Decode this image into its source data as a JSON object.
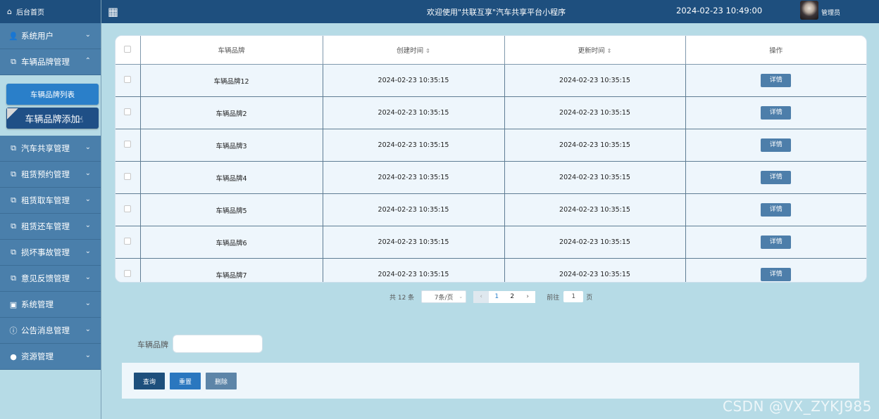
{
  "sidebar": {
    "brand": "后台首页",
    "menu": [
      {
        "label": "系统用户",
        "icon": "user-icon"
      },
      {
        "label": "车辆品牌管理",
        "icon": "folder-icon"
      }
    ],
    "submenu": [
      "车辆品牌列表",
      "车辆品牌添加"
    ],
    "menu2": [
      {
        "label": "汽车共享管理",
        "icon": "folder-icon"
      },
      {
        "label": "租赁预约管理",
        "icon": "folder-icon"
      },
      {
        "label": "租赁取车管理",
        "icon": "folder-icon"
      },
      {
        "label": "租赁还车管理",
        "icon": "folder-icon"
      },
      {
        "label": "损坏事故管理",
        "icon": "folder-icon"
      },
      {
        "label": "意见反馈管理",
        "icon": "folder-icon"
      },
      {
        "label": "系统管理",
        "icon": "image-icon"
      },
      {
        "label": "公告消息管理",
        "icon": "info-icon"
      },
      {
        "label": "资源管理",
        "icon": "location-icon"
      }
    ]
  },
  "header": {
    "welcome": "欢迎使用\"共联互享\"汽车共享平台小程序",
    "datetime": "2024-02-23 10:49:00",
    "user": "管理员"
  },
  "table": {
    "columns": [
      "车辆品牌",
      "创建时间",
      "更新时间",
      "操作"
    ],
    "rows": [
      {
        "brand": "车辆品牌12",
        "created": "2024-02-23 10:35:15",
        "updated": "2024-02-23 10:35:15",
        "action": "详情"
      },
      {
        "brand": "车辆品牌2",
        "created": "2024-02-23 10:35:15",
        "updated": "2024-02-23 10:35:15",
        "action": "详情"
      },
      {
        "brand": "车辆品牌3",
        "created": "2024-02-23 10:35:15",
        "updated": "2024-02-23 10:35:15",
        "action": "详情"
      },
      {
        "brand": "车辆品牌4",
        "created": "2024-02-23 10:35:15",
        "updated": "2024-02-23 10:35:15",
        "action": "详情"
      },
      {
        "brand": "车辆品牌5",
        "created": "2024-02-23 10:35:15",
        "updated": "2024-02-23 10:35:15",
        "action": "详情"
      },
      {
        "brand": "车辆品牌6",
        "created": "2024-02-23 10:35:15",
        "updated": "2024-02-23 10:35:15",
        "action": "详情"
      },
      {
        "brand": "车辆品牌7",
        "created": "2024-02-23 10:35:15",
        "updated": "2024-02-23 10:35:15",
        "action": "详情"
      }
    ]
  },
  "pagination": {
    "total": "共 12 条",
    "page_size": "7条/页",
    "pages": [
      "1",
      "2"
    ],
    "current_page": "1",
    "goto_label": "前往",
    "goto_value": "1",
    "page_suffix": "页"
  },
  "search": {
    "label": "车辆品牌",
    "value": ""
  },
  "actions": {
    "query": "查询",
    "reset": "重置",
    "delete": "删除"
  },
  "watermark": "CSDN @VX_ZYKJ985",
  "colors": {
    "header": "#1e4f7e",
    "menu": "#4a7fab",
    "background": "#b6dbe6",
    "accent": "#2a7fc9"
  }
}
